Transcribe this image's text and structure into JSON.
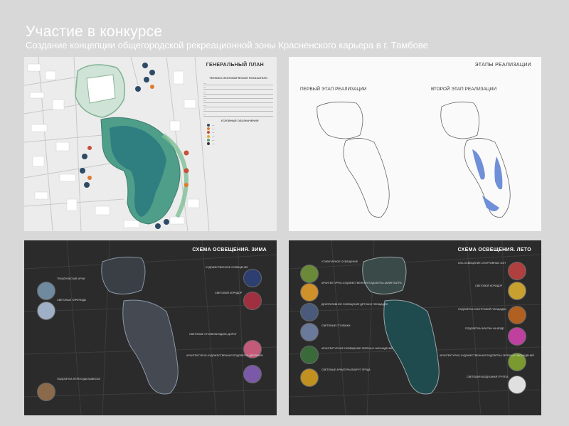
{
  "header": {
    "title": "Участие в конкурсе",
    "subtitle": "Создание концепции общегородской рекреационной зоны Красненского карьера в г. Тамбове"
  },
  "master_plan": {
    "heading": "ГЕНЕРАЛЬНЫЙ ПЛАН",
    "table_title": "ТЕХНИКО-ЭКОНОМИЧЕСКИЕ ПОКАЗАТЕЛИ",
    "legend_title": "УСЛОВНЫЕ ОБОЗНАЧЕНИЯ"
  },
  "stages": {
    "heading": "ЭТАПЫ РЕАЛИЗАЦИИ",
    "first": "ПЕРВЫЙ ЭТАП РЕАЛИЗАЦИИ",
    "second": "ВТОРОЙ ЭТАП РЕАЛИЗАЦИИ"
  },
  "lighting_winter": {
    "heading": "СХЕМА ОСВЕЩЕНИЯ. ЗИМА",
    "labels": [
      "ХУДОЖЕСТВЕННОЕ ОСВЕЩЕНИЕ",
      "ТЕМАТИЧЕСКИЕ АРКИ",
      "СВЕТОВЫЕ ГИРЛЯНДЫ",
      "СВЕТОВОЙ КОРИДОР",
      "СВЕТОВЫЕ СТОЛБИКИ ВДОЛЬ ДОРОГ",
      "АРХИТЕКТУРНО-ХУДОЖЕСТВЕННАЯ ПОДСВЕТКА ДЕРЕВЬЕВ",
      "ПОДСВЕТКА ПЕРЕХОДА ВЫВЕСКИ"
    ]
  },
  "lighting_summer": {
    "heading": "СХЕМА ОСВЕЩЕНИЯ. ЛЕТО",
    "labels": [
      "УТИЛИТАРНОЕ ОСВЕЩЕНИЕ",
      "АРХИТЕКТУРНО-ХУДОЖЕСТВЕННАЯ ПОДСВЕТКА АМФИТЕАТРА",
      "ДЕКОРАТИВНОЕ ОСВЕЩЕНИЕ ДЕТСКИХ ПЛОЩАДОК",
      "СВЕТОВЫЕ СТОЛБИКИ",
      "АРХИТЕКТУРНОЕ ОСВЕЩЕНИЕ ЗЕЛЁНЫХ НАСАЖДЕНИЙ",
      "СВЕТОВЫЕ АРМАТУРЫ ВОКРУГ ПРУДА",
      "LED-ОСВЕЩЕНИЕ СПОРТИВНЫХ ЗОН",
      "СВЕТОВОЙ КОРИДОР",
      "ПОДСВЕТКА СМОТРОВОЙ ПЛОЩАДКИ",
      "ПОДСВЕТКА ФОНТАН НА ВОДЕ",
      "АРХИТЕКТУРНО-ХУДОЖЕСТВЕННАЯ ПОДСВЕТКА ЗЕЛЁНЫХ НАСАЖДЕНИЙ",
      "СВЕТОВАЯ ВОЗДУШНАЯ ГРУППА"
    ]
  },
  "colors": {
    "water": "#3f8f86",
    "park": "#5aa07a",
    "bg": "#d8d8d8",
    "dark": "#2b2b2b",
    "blue_zone": "#6f8fd8"
  }
}
